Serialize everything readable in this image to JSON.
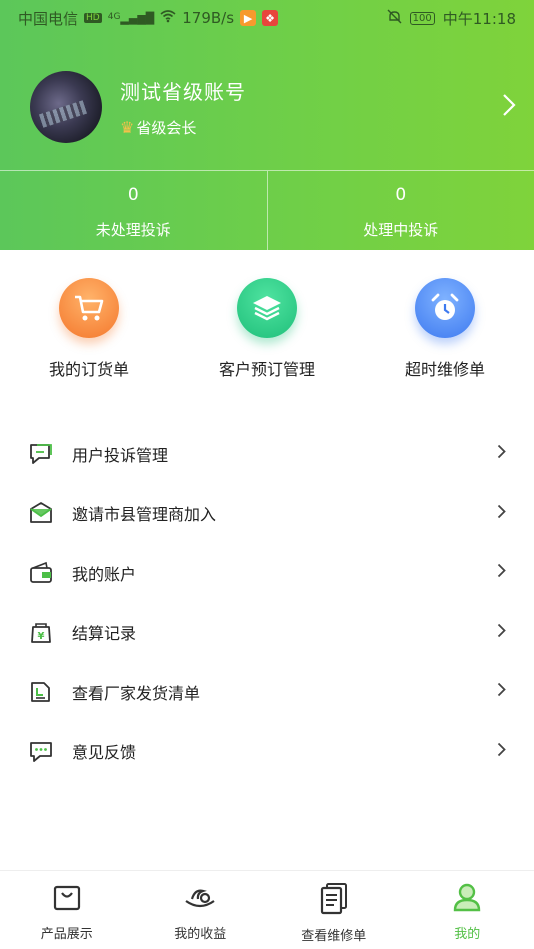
{
  "status_bar": {
    "carrier": "中国电信",
    "hd": "HD",
    "network": "4G",
    "speed": "179B/s",
    "battery": "100",
    "time": "中午11:18"
  },
  "profile": {
    "name": "测试省级账号",
    "role": "省级会长"
  },
  "stats": [
    {
      "value": "0",
      "label": "未处理投诉"
    },
    {
      "value": "0",
      "label": "处理中投诉"
    }
  ],
  "quick_actions": [
    {
      "label": "我的订货单",
      "icon": "cart-icon"
    },
    {
      "label": "客户预订管理",
      "icon": "layers-icon"
    },
    {
      "label": "超时维修单",
      "icon": "alarm-clock-icon"
    }
  ],
  "menu": [
    {
      "label": "用户投诉管理",
      "icon": "complaint-chat-icon"
    },
    {
      "label": "邀请市县管理商加入",
      "icon": "invite-envelope-icon"
    },
    {
      "label": "我的账户",
      "icon": "wallet-icon"
    },
    {
      "label": "结算记录",
      "icon": "yen-bag-icon"
    },
    {
      "label": "查看厂家发货清单",
      "icon": "shipping-list-icon"
    },
    {
      "label": "意见反馈",
      "icon": "feedback-message-icon"
    }
  ],
  "tabs": [
    {
      "label": "产品展示",
      "icon": "shopping-bag-icon",
      "active": false
    },
    {
      "label": "我的收益",
      "icon": "earnings-icon",
      "active": false
    },
    {
      "label": "查看维修单",
      "icon": "document-list-icon",
      "active": false
    },
    {
      "label": "我的",
      "icon": "user-icon",
      "active": true
    }
  ],
  "colors": {
    "header_gradient_start": "#5cc75a",
    "header_gradient_end": "#7fd33b",
    "active_tab": "#53c046",
    "menu_icon_accent": "#4cbf47"
  }
}
